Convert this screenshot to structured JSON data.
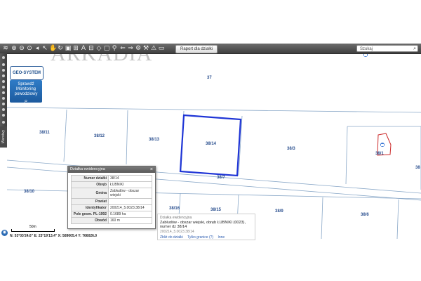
{
  "toolbar": {
    "report_button": "Raport dla działki",
    "search_placeholder": "Szukaj",
    "icons": [
      "layers-icon",
      "zoom-in-icon",
      "zoom-out-icon",
      "zoom-extent-icon",
      "back-icon",
      "forward-icon",
      "select-arrow-icon",
      "hand-pan-icon",
      "print-icon",
      "ruler-icon",
      "area-icon",
      "text-icon",
      "measure-icon",
      "pin-icon",
      "refresh-icon",
      "search-icon",
      "link-icon",
      "car-icon"
    ]
  },
  "watermark": "ARKADIA",
  "logo": {
    "text": "GEO-SYSTEM"
  },
  "flood_button": {
    "line1": "Sprawdź",
    "line2": "Monitoring",
    "line3": "powodziowy"
  },
  "layers_tab": "Warstwy",
  "parcels": [
    "37",
    "38/11",
    "38/12",
    "38/13",
    "38/14",
    "38/3",
    "38/1",
    "38/7",
    "38/10",
    "38/16",
    "38/15",
    "38/9",
    "38/6",
    "38"
  ],
  "popup": {
    "title": "Działka ewidencyjna",
    "rows": [
      {
        "k": "Numer działki",
        "v": "38/14"
      },
      {
        "k": "Obręb",
        "v": "ŁUBNIKI"
      },
      {
        "k": "Gmina",
        "v": "Zabłudów - obszar wiejski"
      },
      {
        "k": "Powiat",
        "v": ""
      },
      {
        "k": "Identyfikator",
        "v": "200214_5.0023.38/14"
      },
      {
        "k": "Pole geom. PL-1992",
        "v": "0.1689 ha"
      },
      {
        "k": "Obwód",
        "v": "160 m"
      }
    ]
  },
  "bottom_panel": {
    "category": "Działka ewidencyjna",
    "main": "Zabłudów - obszar wiejski, obręb ŁUBNIKI (0023), numer dz 38/14",
    "identifier": "200214_5.0023.38/14",
    "links": [
      "Zbliż do działki",
      "Tylko granice (?)",
      "Inne"
    ]
  },
  "scale": {
    "label": "50m"
  },
  "coords": "N: 53°03'24.6\" E: 23°19'13.4\" X: 589005.4 Y: 766026.0",
  "colors": {
    "selected_parcel": "#1f35d6",
    "building": "#cc2b2b",
    "parcel_line": "#8aa8c8"
  }
}
